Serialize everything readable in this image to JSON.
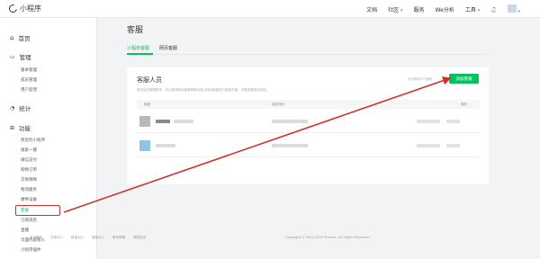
{
  "app": {
    "title": "小程序"
  },
  "topnav": {
    "docs": "文档",
    "community": "社区",
    "service": "服务",
    "we_analysis": "We分析",
    "tools": "工具"
  },
  "sidebar": {
    "home": "首页",
    "manage": "管理",
    "manage_items": [
      "版本管理",
      "成员管理",
      "用户反馈"
    ],
    "stats": "统计",
    "features": "功能",
    "feature_items": [
      "附近的小程序",
      "搜索一键",
      "微信支付",
      "购物订单",
      "交易保障",
      "物流服务",
      "硬件设备",
      "客服",
      "订阅消息",
      "直播",
      "页面内容接入",
      "小程序插件"
    ]
  },
  "main": {
    "page_title": "客服",
    "tabs": [
      "小程序客服",
      "网页客服"
    ],
    "card": {
      "title": "客服人员",
      "description": "绑定后的客服账号，可以登录网页客服和移动端小程序客服进行客服沟通，详情查看使用说明。",
      "limit": "还可添加2个客服",
      "add_button": "添加客服",
      "columns": [
        "客服",
        "绑定时间",
        "操作"
      ]
    }
  },
  "footer": {
    "links": [
      "关于腾讯",
      "文档中心",
      "辟谣中心",
      "客服中心",
      "联系邮箱",
      "侵权投诉"
    ],
    "copyright": "Copyright © 2012-2023 Tencent. All Rights Reserved."
  },
  "colors": {
    "accent": "#07c160",
    "annotation": "#d0312d"
  }
}
